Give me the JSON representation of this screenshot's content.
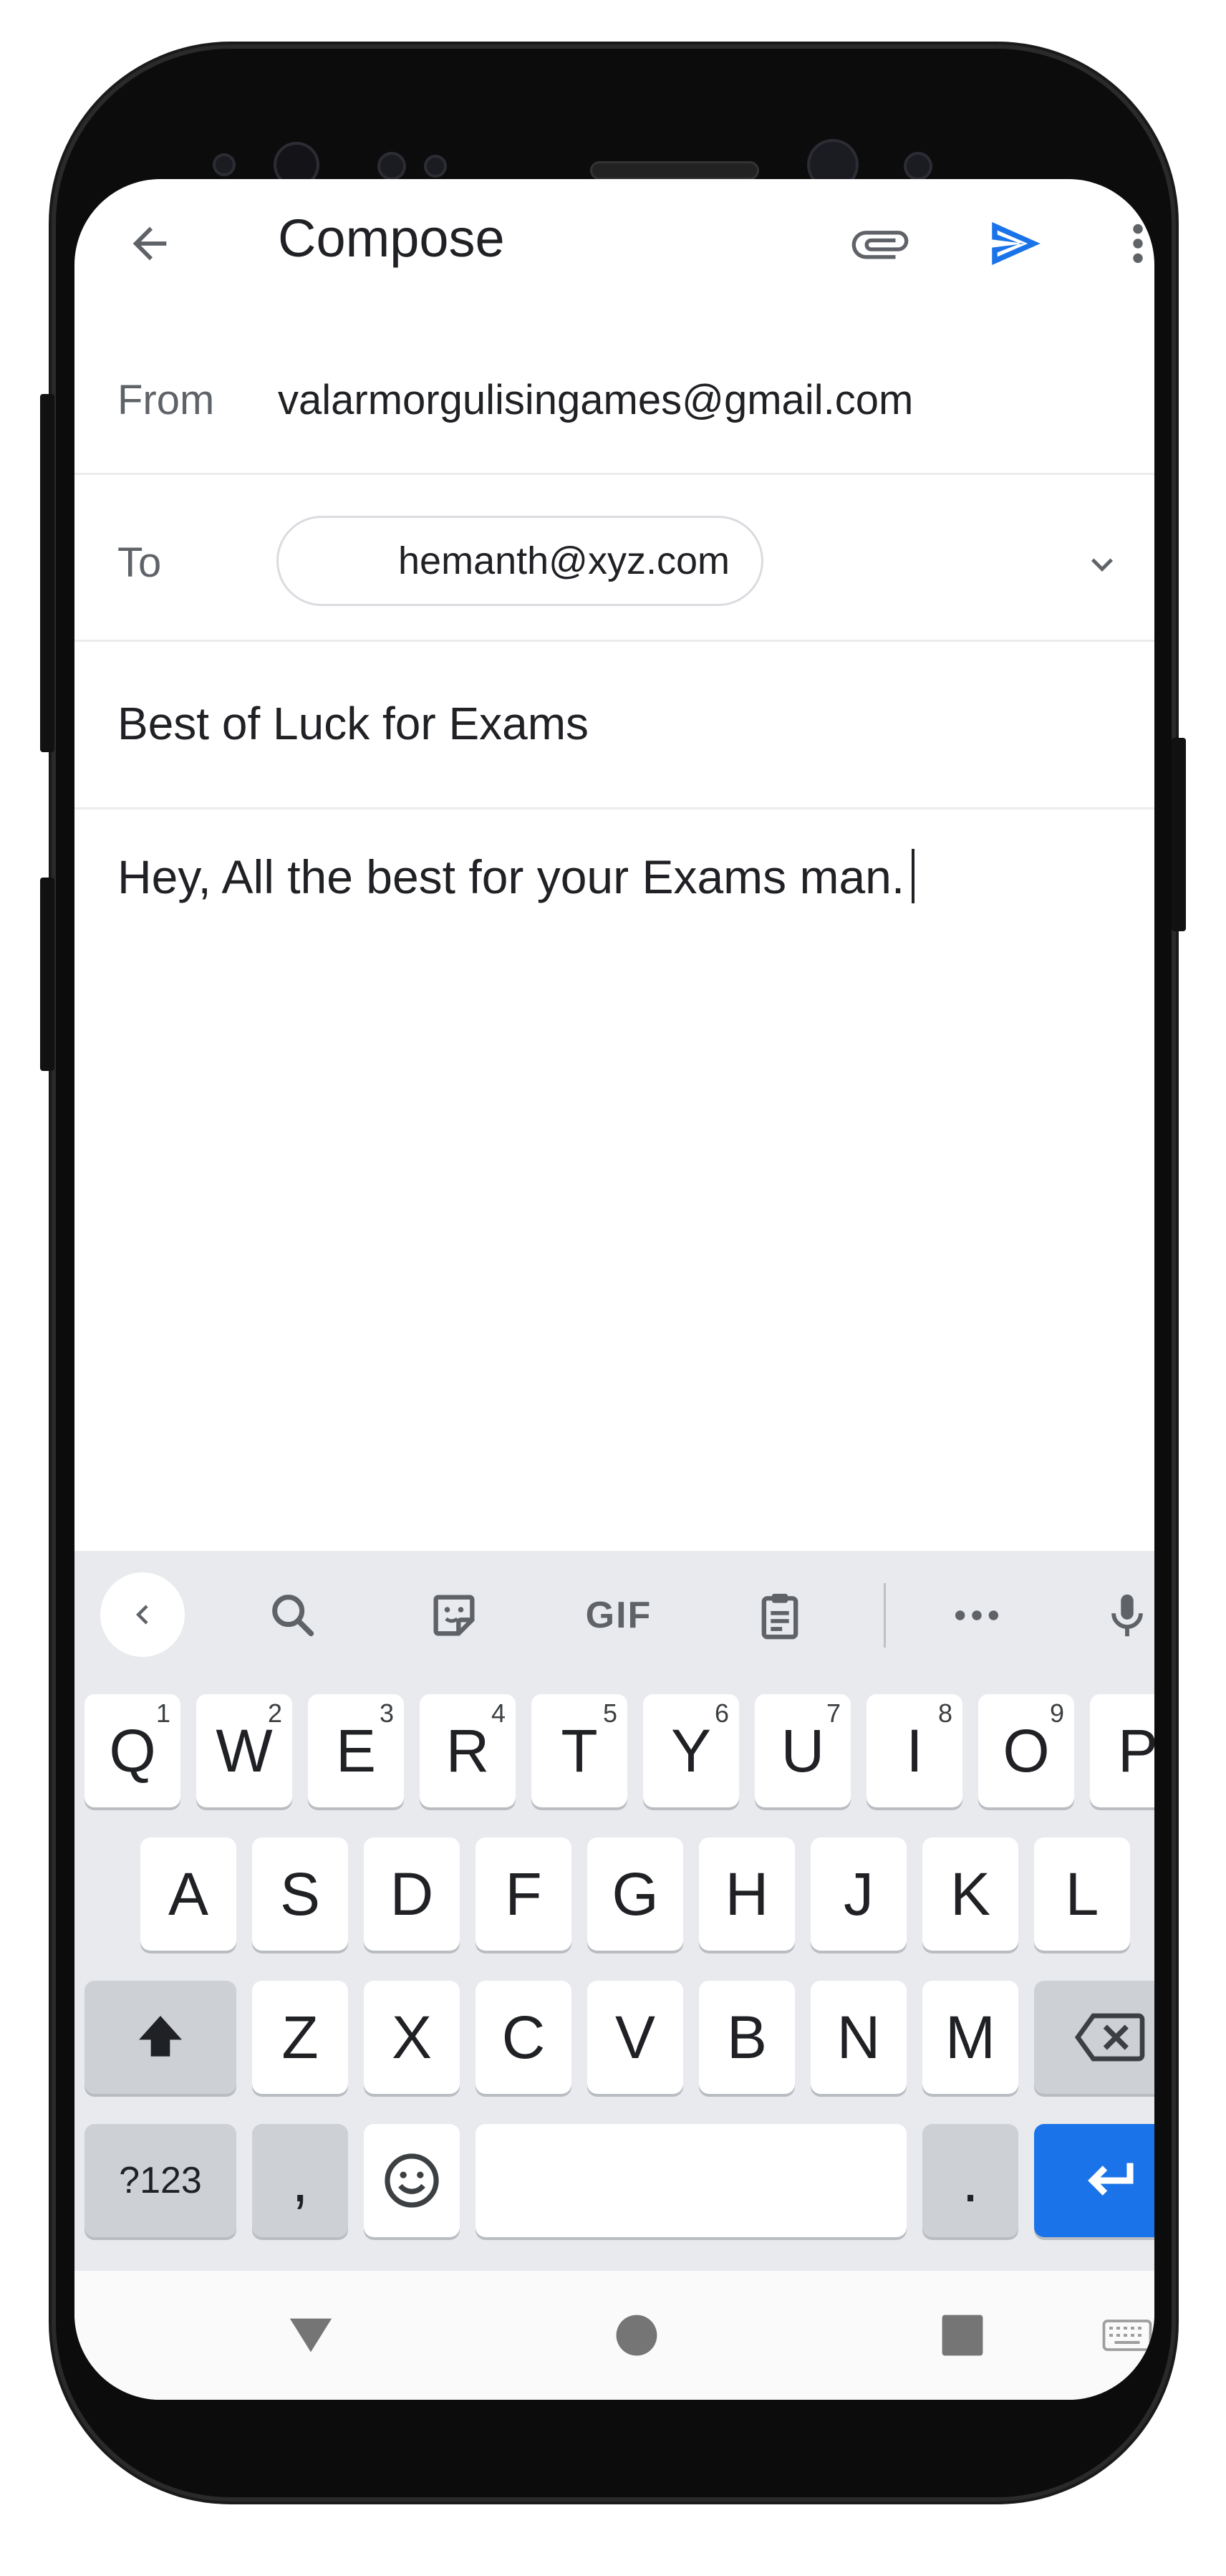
{
  "compose": {
    "title": "Compose",
    "from_label": "From",
    "from_value": "valarmorgulisingames@gmail.com",
    "to_label": "To",
    "to_chip": "hemanth@xyz.com",
    "subject": "Best of Luck for Exams",
    "body": "Hey, All the best for your Exams man."
  },
  "icons": {
    "back": "arrow-back-icon",
    "attach": "paperclip-icon",
    "send": "send-icon",
    "more": "more-vert-icon",
    "expand": "chevron-down-icon"
  },
  "colors": {
    "send": "#1a73e8",
    "enter_key": "#1a73e8"
  },
  "keyboard": {
    "toolbar": {
      "gif": "GIF"
    },
    "row1": [
      {
        "k": "Q",
        "n": "1"
      },
      {
        "k": "W",
        "n": "2"
      },
      {
        "k": "E",
        "n": "3"
      },
      {
        "k": "R",
        "n": "4"
      },
      {
        "k": "T",
        "n": "5"
      },
      {
        "k": "Y",
        "n": "6"
      },
      {
        "k": "U",
        "n": "7"
      },
      {
        "k": "I",
        "n": "8"
      },
      {
        "k": "O",
        "n": "9"
      },
      {
        "k": "P",
        "n": ""
      }
    ],
    "row2": [
      "A",
      "S",
      "D",
      "F",
      "G",
      "H",
      "J",
      "K",
      "L"
    ],
    "row3": [
      "Z",
      "X",
      "C",
      "V",
      "B",
      "N",
      "M"
    ],
    "symbols": "?123",
    "comma": ",",
    "period": "."
  }
}
